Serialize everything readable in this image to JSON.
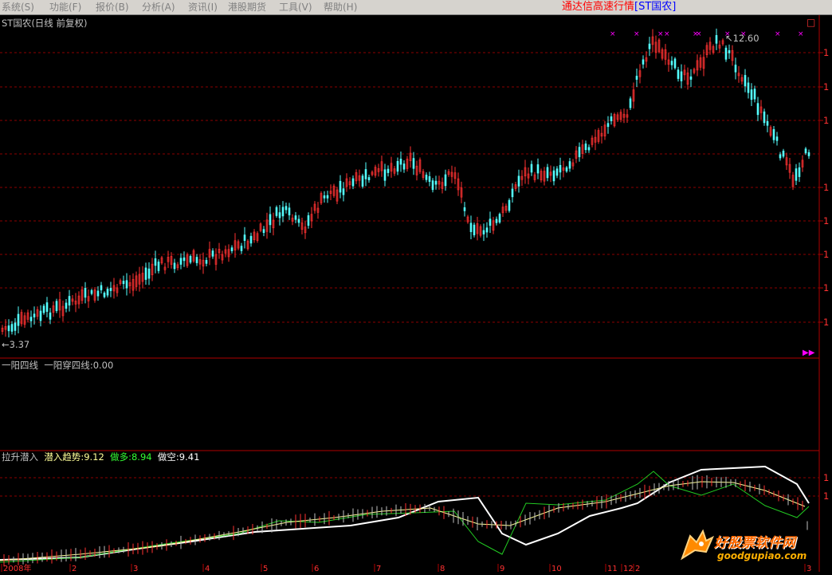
{
  "menu": [
    "系统(S)",
    "功能(F)",
    "报价(B)",
    "分析(A)",
    "资讯(I)",
    "港股期货",
    "工具(V)",
    "帮助(H)"
  ],
  "app_title": "通达信高速行情",
  "app_symbol": "[ST国农]",
  "price_panel": {
    "label": "ST国农(日线 前复权)",
    "high_label": "12.60",
    "low_label": "3.37",
    "axis_ticks": [
      "1",
      "1",
      "1",
      "1",
      "1",
      "1",
      "1",
      "1"
    ]
  },
  "indicator1": {
    "name": "一阳四线",
    "series": [
      {
        "name": "一阳穿四线",
        "value": "0.00"
      }
    ]
  },
  "indicator2": {
    "name": "拉升潜入",
    "series": [
      {
        "name": "潜入趋势",
        "value": "9.12",
        "color": "#ffff99"
      },
      {
        "name": "做多",
        "value": "8.94",
        "color": "#33ff33"
      },
      {
        "name": "做空",
        "value": "9.41",
        "color": "#ffffff"
      }
    ],
    "axis_ticks": [
      "1",
      "1"
    ]
  },
  "date_axis": [
    "2008年",
    "2",
    "3",
    "4",
    "5",
    "6",
    "7",
    "8",
    "9",
    "10",
    "11",
    "12",
    "2",
    "3"
  ],
  "logo": {
    "text": "好股票软件网",
    "url": "goodgupiao.com"
  },
  "colors": {
    "up": "#ff3232",
    "down": "#54ffff",
    "grid": "#8b0000",
    "signal": "#ff00ff"
  }
}
